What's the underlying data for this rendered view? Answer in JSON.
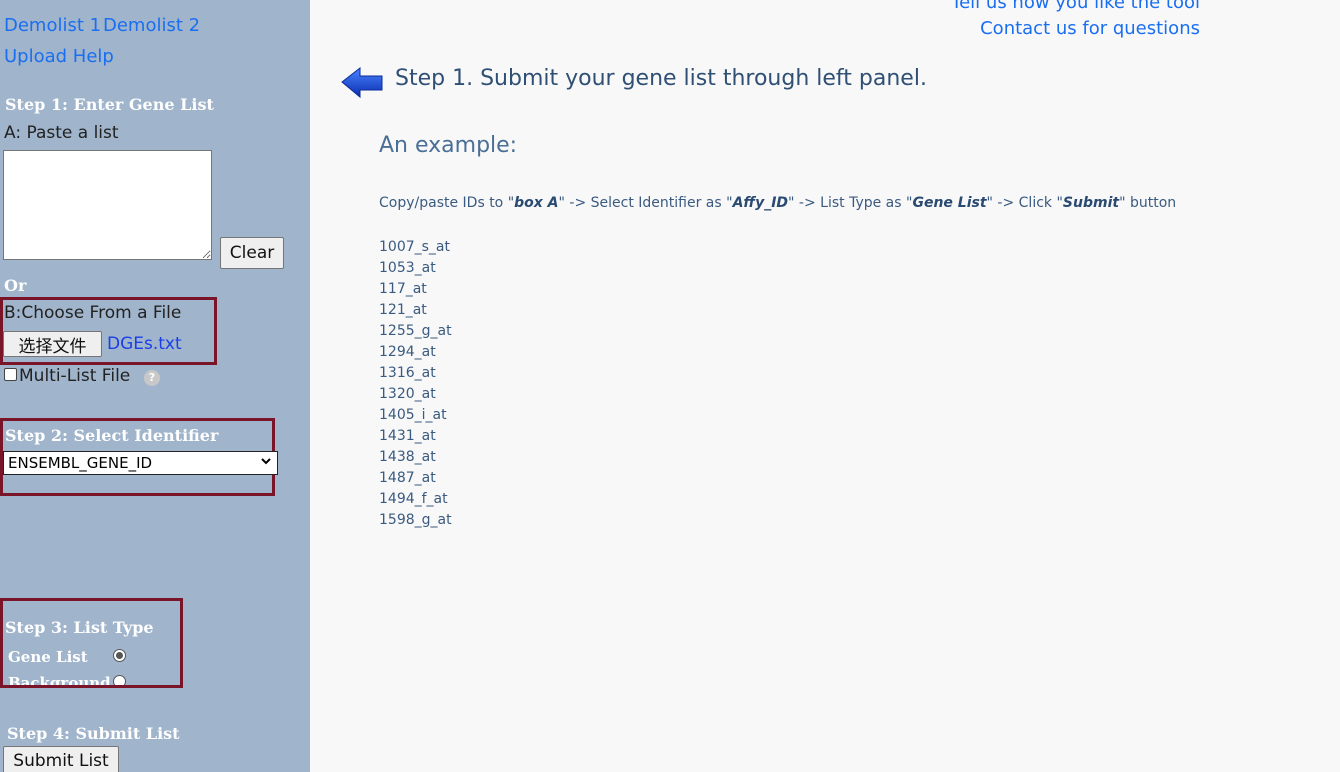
{
  "sidebar": {
    "demolist1": "Demolist 1",
    "demolist2": "Demolist 2",
    "upload_help": "Upload Help",
    "step1_heading": "Step 1: Enter Gene List",
    "paste_label": "A: Paste a list",
    "clear_label": "Clear",
    "or_label": "Or",
    "choose_file_label": "B:Choose From a File",
    "choose_file_button": "选择文件",
    "file_name": "DGEs.txt",
    "multi_list_label": "Multi-List File",
    "help_glyph": "?",
    "step2_heading": "Step 2: Select Identifier",
    "identifier_value": "ENSEMBL_GENE_ID",
    "step3_heading": "Step 3: List Type",
    "gene_list_label": "Gene List",
    "background_label": "Background",
    "step4_heading": "Step 4: Submit List",
    "submit_label": "Submit List"
  },
  "main": {
    "feedback_link": "Tell us how you like the tool",
    "contact_link": "Contact us for questions",
    "step1_text": "Step 1. Submit your gene list through left panel.",
    "example_heading": "An example:",
    "instruction": {
      "p1": "Copy/paste IDs to \"",
      "b1": "box A",
      "p2": "\" -> Select Identifier as  \"",
      "b2": "Affy_ID",
      "p3": "\" -> List Type as \"",
      "b3": "Gene List",
      "p4": "\" -> Click \"",
      "b4": "Submit",
      "p5": "\" button"
    },
    "example_ids": [
      "1007_s_at",
      "1053_at",
      "117_at",
      "121_at",
      "1255_g_at",
      "1294_at",
      "1316_at",
      "1320_at",
      "1405_i_at",
      "1431_at",
      "1438_at",
      "1487_at",
      "1494_f_at",
      "1598_g_at"
    ]
  },
  "colors": {
    "sidebar_bg": "#a0b5cc",
    "link": "#1a6ef0",
    "highlight_box": "#7a1428",
    "arrow": "#1446c8"
  },
  "icons": {
    "back_arrow": "left-arrow-icon",
    "help": "question-circle-icon",
    "dropdown": "chevron-down-icon"
  }
}
